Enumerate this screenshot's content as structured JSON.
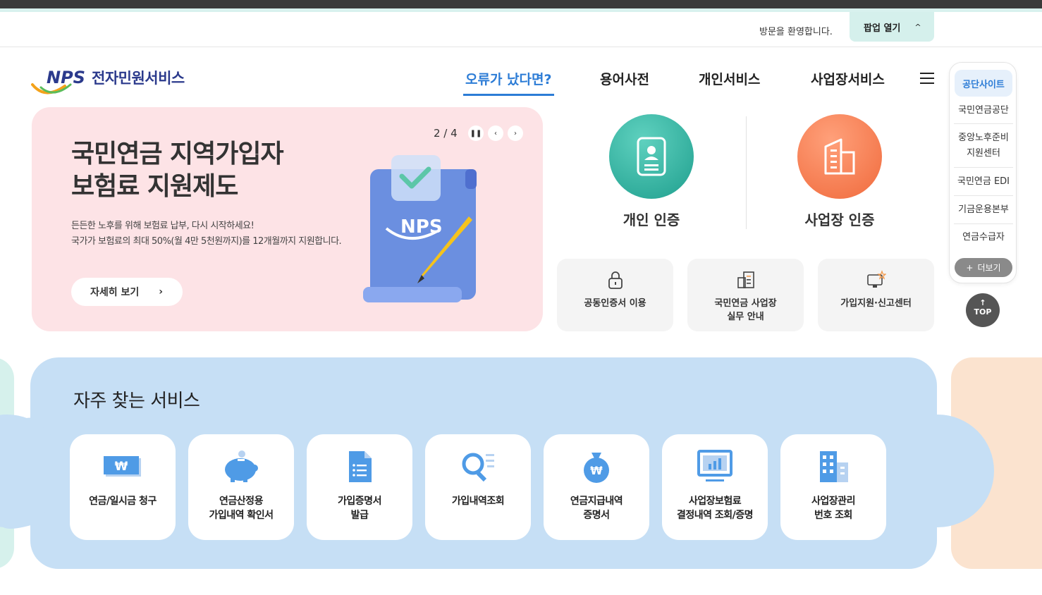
{
  "utility": {
    "welcome": "방문을 환영합니다.",
    "popup_label": "팝업 열기"
  },
  "logo": {
    "abbr": "NPS",
    "service_name": "전자민원서비스"
  },
  "gnb": {
    "items": [
      {
        "label": "오류가 났다면?"
      },
      {
        "label": "용어사전"
      },
      {
        "label": "개인서비스"
      },
      {
        "label": "사업장서비스"
      }
    ]
  },
  "hero": {
    "title_line1": "국민연금 지역가입자",
    "title_line2": "보험료 지원제도",
    "desc_line1": "든든한 노후를 위해 보험료 납부, 다시 시작하세요!",
    "desc_line2": "국가가 보험료의 최대 50%(월 4만 5천원까지)를 12개월까지 지원합니다.",
    "more_label": "자세히 보기",
    "counter": "2 / 4",
    "illust_text": "NPS"
  },
  "certs": [
    {
      "label": "개인 인증",
      "color": "#2fb5a4"
    },
    {
      "label": "사업장 인증",
      "color": "#f47a4f"
    }
  ],
  "quick": [
    {
      "label": "공동인증서 이용"
    },
    {
      "label_line1": "국민연금 사업장",
      "label_line2": "실무 안내"
    },
    {
      "label": "가입지원·신고센터"
    }
  ],
  "side": {
    "head": "공단사이트",
    "items": [
      {
        "label": "국민연금공단"
      },
      {
        "label_line1": "중앙노후준비",
        "label_line2": "지원센터"
      },
      {
        "label": "국민연금 EDI"
      },
      {
        "label": "기금운용본부"
      },
      {
        "label": "연금수급자"
      }
    ],
    "more": "더보기",
    "top": "TOP"
  },
  "frequent": {
    "title": "자주 찾는 서비스",
    "items": [
      {
        "line1": "연금/일시금 청구",
        "line2": ""
      },
      {
        "line1": "연금산정용",
        "line2": "가입내역 확인서"
      },
      {
        "line1": "가입증명서",
        "line2": "발급"
      },
      {
        "line1": "가입내역조회",
        "line2": ""
      },
      {
        "line1": "연금지급내역",
        "line2": "증명서"
      },
      {
        "line1": "사업장보험료",
        "line2": "결정내역 조회/증명"
      },
      {
        "line1": "사업장관리",
        "line2": "번호 조회"
      }
    ]
  },
  "colors": {
    "accent": "#2c7cd6",
    "hero_bg": "#fde3e6",
    "freq_bg": "#c6dff5",
    "mint": "#d5f0ec"
  }
}
